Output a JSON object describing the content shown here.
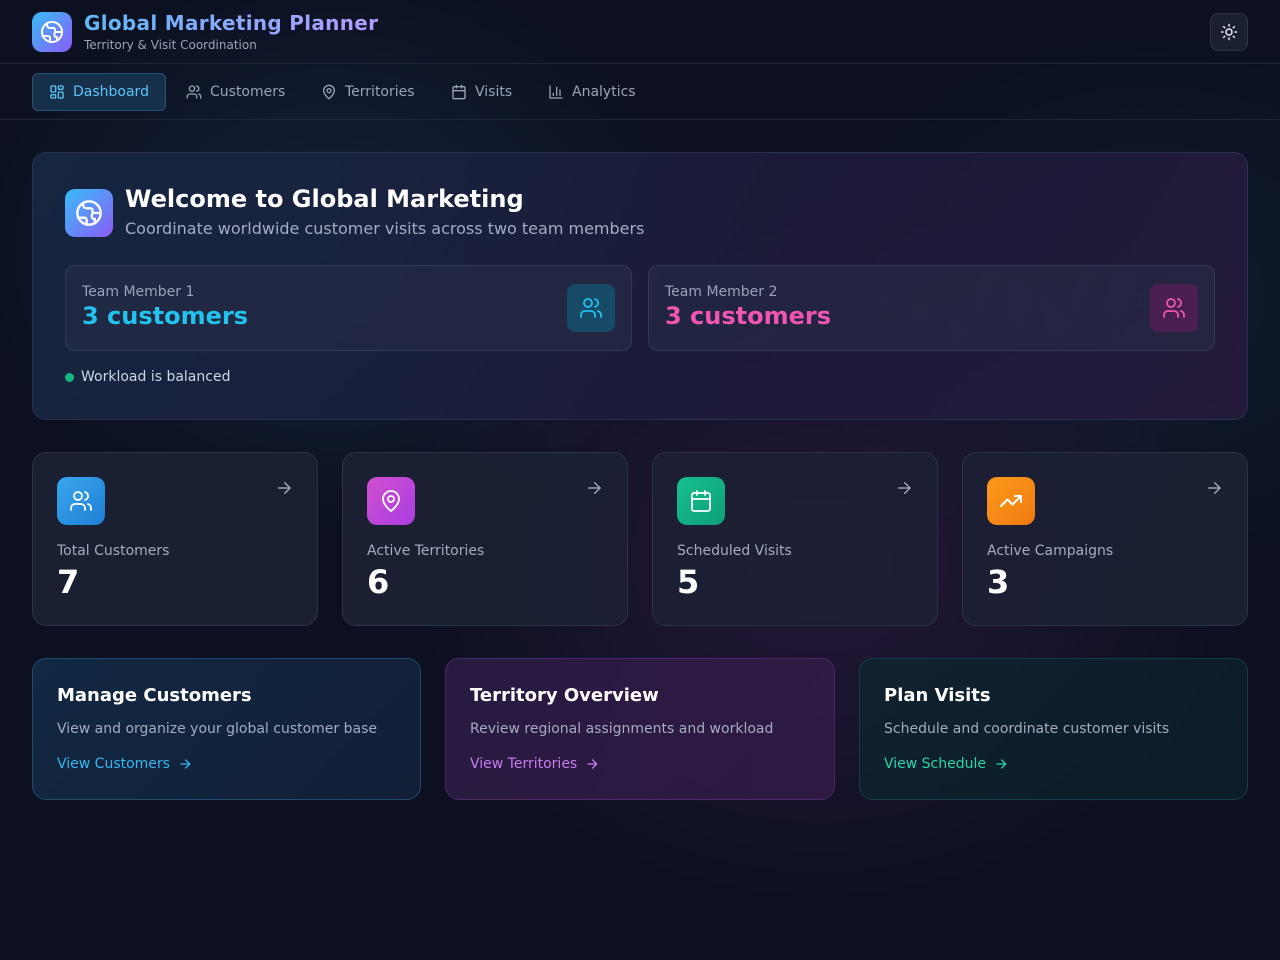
{
  "app": {
    "title": "Global Marketing Planner",
    "subtitle": "Territory & Visit Coordination",
    "logo_icon": "globe-icon",
    "theme_toggle_icon": "sun-icon"
  },
  "nav": {
    "items": [
      {
        "label": "Dashboard",
        "icon": "layout-grid-icon",
        "active": true
      },
      {
        "label": "Customers",
        "icon": "users-icon"
      },
      {
        "label": "Territories",
        "icon": "map-pin-icon"
      },
      {
        "label": "Visits",
        "icon": "calendar-icon"
      },
      {
        "label": "Analytics",
        "icon": "bar-chart-icon"
      }
    ]
  },
  "welcome": {
    "title": "Welcome to Global Marketing",
    "subtitle": "Coordinate worldwide customer visits across two team members",
    "members": [
      {
        "label": "Team Member 1",
        "value": "3 customers",
        "color": "#22c4ee"
      },
      {
        "label": "Team Member 2",
        "value": "3 customers",
        "color": "#f056b0"
      }
    ],
    "status": "Workload is balanced",
    "status_color": "#10b981"
  },
  "stats": [
    {
      "label": "Total Customers",
      "value": "7",
      "icon": "users-icon",
      "color": "#2a9de8"
    },
    {
      "label": "Active Territories",
      "value": "6",
      "icon": "map-pin-icon",
      "color": "#c13fd6"
    },
    {
      "label": "Scheduled Visits",
      "value": "5",
      "icon": "calendar-icon",
      "color": "#10b389"
    },
    {
      "label": "Active Campaigns",
      "value": "3",
      "icon": "trending-up-icon",
      "color": "#f5870e"
    }
  ],
  "actions": [
    {
      "title": "Manage Customers",
      "description": "View and organize your global customer base",
      "link": "View Customers",
      "color": "#38b6f0"
    },
    {
      "title": "Territory Overview",
      "description": "Review regional assignments and workload",
      "link": "View Territories",
      "color": "#c77df0"
    },
    {
      "title": "Plan Visits",
      "description": "Schedule and coordinate customer visits",
      "link": "View Schedule",
      "color": "#2dd4a8"
    }
  ]
}
